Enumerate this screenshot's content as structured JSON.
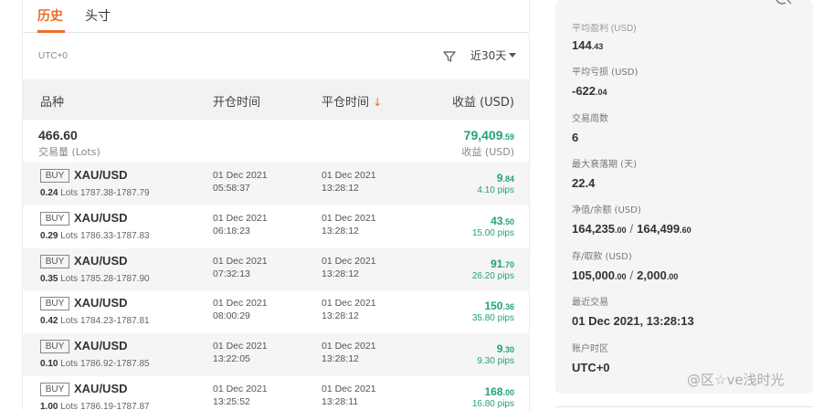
{
  "tabs": {
    "history": "历史",
    "size": "头寸"
  },
  "filter": {
    "timezone": "UTC+0",
    "period": "近30天"
  },
  "table": {
    "col_symbol": "品种",
    "col_open": "开仓时间",
    "col_close": "平仓时间",
    "col_close_arrow": "↓",
    "col_profit": "收益 (USD)"
  },
  "summary": {
    "volume": "466.60",
    "volume_label": "交易量 (Lots)",
    "profit_main": "79,409",
    "profit_dec": ".59",
    "profit_label": "收益 (USD)"
  },
  "trades": [
    {
      "side": "BUY",
      "symbol": "XAU/USD",
      "lots": "0.24",
      "lots_unit": "Lots",
      "range": "1787.38-1787.79",
      "open_date": "01 Dec 2021",
      "open_time": "05:58:37",
      "close_date": "01 Dec 2021",
      "close_time": "13:28:12",
      "profit_main": "9",
      "profit_dec": ".84",
      "pips": "4.10 pips"
    },
    {
      "side": "BUY",
      "symbol": "XAU/USD",
      "lots": "0.29",
      "lots_unit": "Lots",
      "range": "1786.33-1787.83",
      "open_date": "01 Dec 2021",
      "open_time": "06:18:23",
      "close_date": "01 Dec 2021",
      "close_time": "13:28:12",
      "profit_main": "43",
      "profit_dec": ".50",
      "pips": "15.00 pips"
    },
    {
      "side": "BUY",
      "symbol": "XAU/USD",
      "lots": "0.35",
      "lots_unit": "Lots",
      "range": "1785.28-1787.90",
      "open_date": "01 Dec 2021",
      "open_time": "07:32:13",
      "close_date": "01 Dec 2021",
      "close_time": "13:28:12",
      "profit_main": "91",
      "profit_dec": ".70",
      "pips": "26.20 pips"
    },
    {
      "side": "BUY",
      "symbol": "XAU/USD",
      "lots": "0.42",
      "lots_unit": "Lots",
      "range": "1784.23-1787.81",
      "open_date": "01 Dec 2021",
      "open_time": "08:00:29",
      "close_date": "01 Dec 2021",
      "close_time": "13:28:12",
      "profit_main": "150",
      "profit_dec": ".36",
      "pips": "35.80 pips"
    },
    {
      "side": "BUY",
      "symbol": "XAU/USD",
      "lots": "0.10",
      "lots_unit": "Lots",
      "range": "1786.92-1787.85",
      "open_date": "01 Dec 2021",
      "open_time": "13:22:05",
      "close_date": "01 Dec 2021",
      "close_time": "13:28:12",
      "profit_main": "9",
      "profit_dec": ".30",
      "pips": "9.30 pips"
    },
    {
      "side": "BUY",
      "symbol": "XAU/USD",
      "lots": "1.00",
      "lots_unit": "Lots",
      "range": "1786.19-1787.87",
      "open_date": "01 Dec 2021",
      "open_time": "13:25:52",
      "close_date": "01 Dec 2021",
      "close_time": "13:28:11",
      "profit_main": "168",
      "profit_dec": ".00",
      "pips": "16.80 pips"
    }
  ],
  "stats": {
    "cut_label": "平均盈利 (USD)",
    "avg_profit_main": "144",
    "avg_profit_dec": ".43",
    "avg_loss_label": "平均亏损 (USD)",
    "avg_loss_main": "-622",
    "avg_loss_dec": ".04",
    "trade_weeks_label": "交易周数",
    "trade_weeks": "6",
    "max_drawdown_label": "最大衰落期 (天)",
    "max_drawdown": "22.4",
    "equity_label": "净值/余额 (USD)",
    "equity_main": "164,235",
    "equity_dec": ".00",
    "balance_main": "164,499",
    "balance_dec": ".60",
    "deposit_label": "存/取款 (USD)",
    "deposit_main": "105,000",
    "deposit_dec": ".00",
    "withdraw_main": "2,000",
    "withdraw_dec": ".00",
    "last_trade_label": "最近交易",
    "last_trade": "01 Dec 2021, 13:28:13",
    "tz_label": "账户时区",
    "tz": "UTC+0",
    "separator": "/"
  },
  "watermark": "@区☆ve浅时光",
  "colors": {
    "accent": "#ee6b26",
    "profit": "#26a17b"
  },
  "icons": {
    "filter": "filter-icon",
    "dropdown": "chevron-down-icon",
    "sort": "arrow-down-icon"
  }
}
